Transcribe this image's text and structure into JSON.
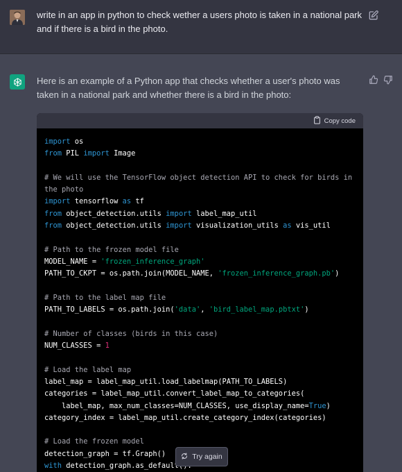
{
  "user_message": {
    "text": "write in an app in python to check wether a users photo is taken in a national park and if there is a bird in the photo."
  },
  "assistant_message": {
    "text": "Here is an example of a Python app that checks whether a user's photo was taken in a national park and whether there is a bird in the photo:"
  },
  "code_block": {
    "copy_label": "Copy code",
    "lines": [
      [
        {
          "t": "import",
          "c": "kw"
        },
        {
          "t": " os"
        }
      ],
      [
        {
          "t": "from",
          "c": "kw"
        },
        {
          "t": " PIL "
        },
        {
          "t": "import",
          "c": "kw"
        },
        {
          "t": " Image"
        }
      ],
      [],
      [
        {
          "t": "# We will use the TensorFlow object detection API to check for birds in",
          "c": "cm"
        }
      ],
      [
        {
          "t": "the photo",
          "c": "cm"
        }
      ],
      [
        {
          "t": "import",
          "c": "kw"
        },
        {
          "t": " tensorflow "
        },
        {
          "t": "as",
          "c": "kw"
        },
        {
          "t": " tf"
        }
      ],
      [
        {
          "t": "from",
          "c": "kw"
        },
        {
          "t": " object_detection.utils "
        },
        {
          "t": "import",
          "c": "kw"
        },
        {
          "t": " label_map_util"
        }
      ],
      [
        {
          "t": "from",
          "c": "kw"
        },
        {
          "t": " object_detection.utils "
        },
        {
          "t": "import",
          "c": "kw"
        },
        {
          "t": " visualization_utils "
        },
        {
          "t": "as",
          "c": "kw"
        },
        {
          "t": " vis_util"
        }
      ],
      [],
      [
        {
          "t": "# Path to the frozen model file",
          "c": "cm"
        }
      ],
      [
        {
          "t": "MODEL_NAME = "
        },
        {
          "t": "'frozen_inference_graph'",
          "c": "str"
        }
      ],
      [
        {
          "t": "PATH_TO_CKPT = os.path.join(MODEL_NAME, "
        },
        {
          "t": "'frozen_inference_graph.pb'",
          "c": "str"
        },
        {
          "t": ")"
        }
      ],
      [],
      [
        {
          "t": "# Path to the label map file",
          "c": "cm"
        }
      ],
      [
        {
          "t": "PATH_TO_LABELS = os.path.join("
        },
        {
          "t": "'data'",
          "c": "str"
        },
        {
          "t": ", "
        },
        {
          "t": "'bird_label_map.pbtxt'",
          "c": "str"
        },
        {
          "t": ")"
        }
      ],
      [],
      [
        {
          "t": "# Number of classes (birds in this case)",
          "c": "cm"
        }
      ],
      [
        {
          "t": "NUM_CLASSES = "
        },
        {
          "t": "1",
          "c": "num"
        }
      ],
      [],
      [
        {
          "t": "# Load the label map",
          "c": "cm"
        }
      ],
      [
        {
          "t": "label_map = label_map_util.load_labelmap(PATH_TO_LABELS)"
        }
      ],
      [
        {
          "t": "categories = label_map_util.convert_label_map_to_categories("
        }
      ],
      [
        {
          "t": "    label_map, max_num_classes=NUM_CLASSES, use_display_name="
        },
        {
          "t": "True",
          "c": "kw"
        },
        {
          "t": ")"
        }
      ],
      [
        {
          "t": "category_index = label_map_util.create_category_index(categories)"
        }
      ],
      [],
      [
        {
          "t": "# Load the frozen model",
          "c": "cm"
        }
      ],
      [
        {
          "t": "detection_graph = tf.Graph()"
        }
      ],
      [
        {
          "t": "with",
          "c": "kw"
        },
        {
          "t": " detection_graph.as_default():"
        }
      ]
    ]
  },
  "try_again_label": "Try again",
  "icons": {
    "user_avatar": "user-photo-avatar",
    "assistant_avatar": "openai-logo-icon",
    "edit": "edit-icon",
    "thumbs_up": "thumbs-up-icon",
    "thumbs_down": "thumbs-down-icon",
    "copy": "clipboard-icon",
    "refresh": "refresh-icon"
  },
  "colors": {
    "user_bg": "#343541",
    "assistant_bg": "#444654",
    "brand": "#10a37f",
    "code_bg": "#000000",
    "keyword": "#2e95d3",
    "string": "#00a67d",
    "number": "#df3079",
    "comment": "#a9a9b3"
  }
}
